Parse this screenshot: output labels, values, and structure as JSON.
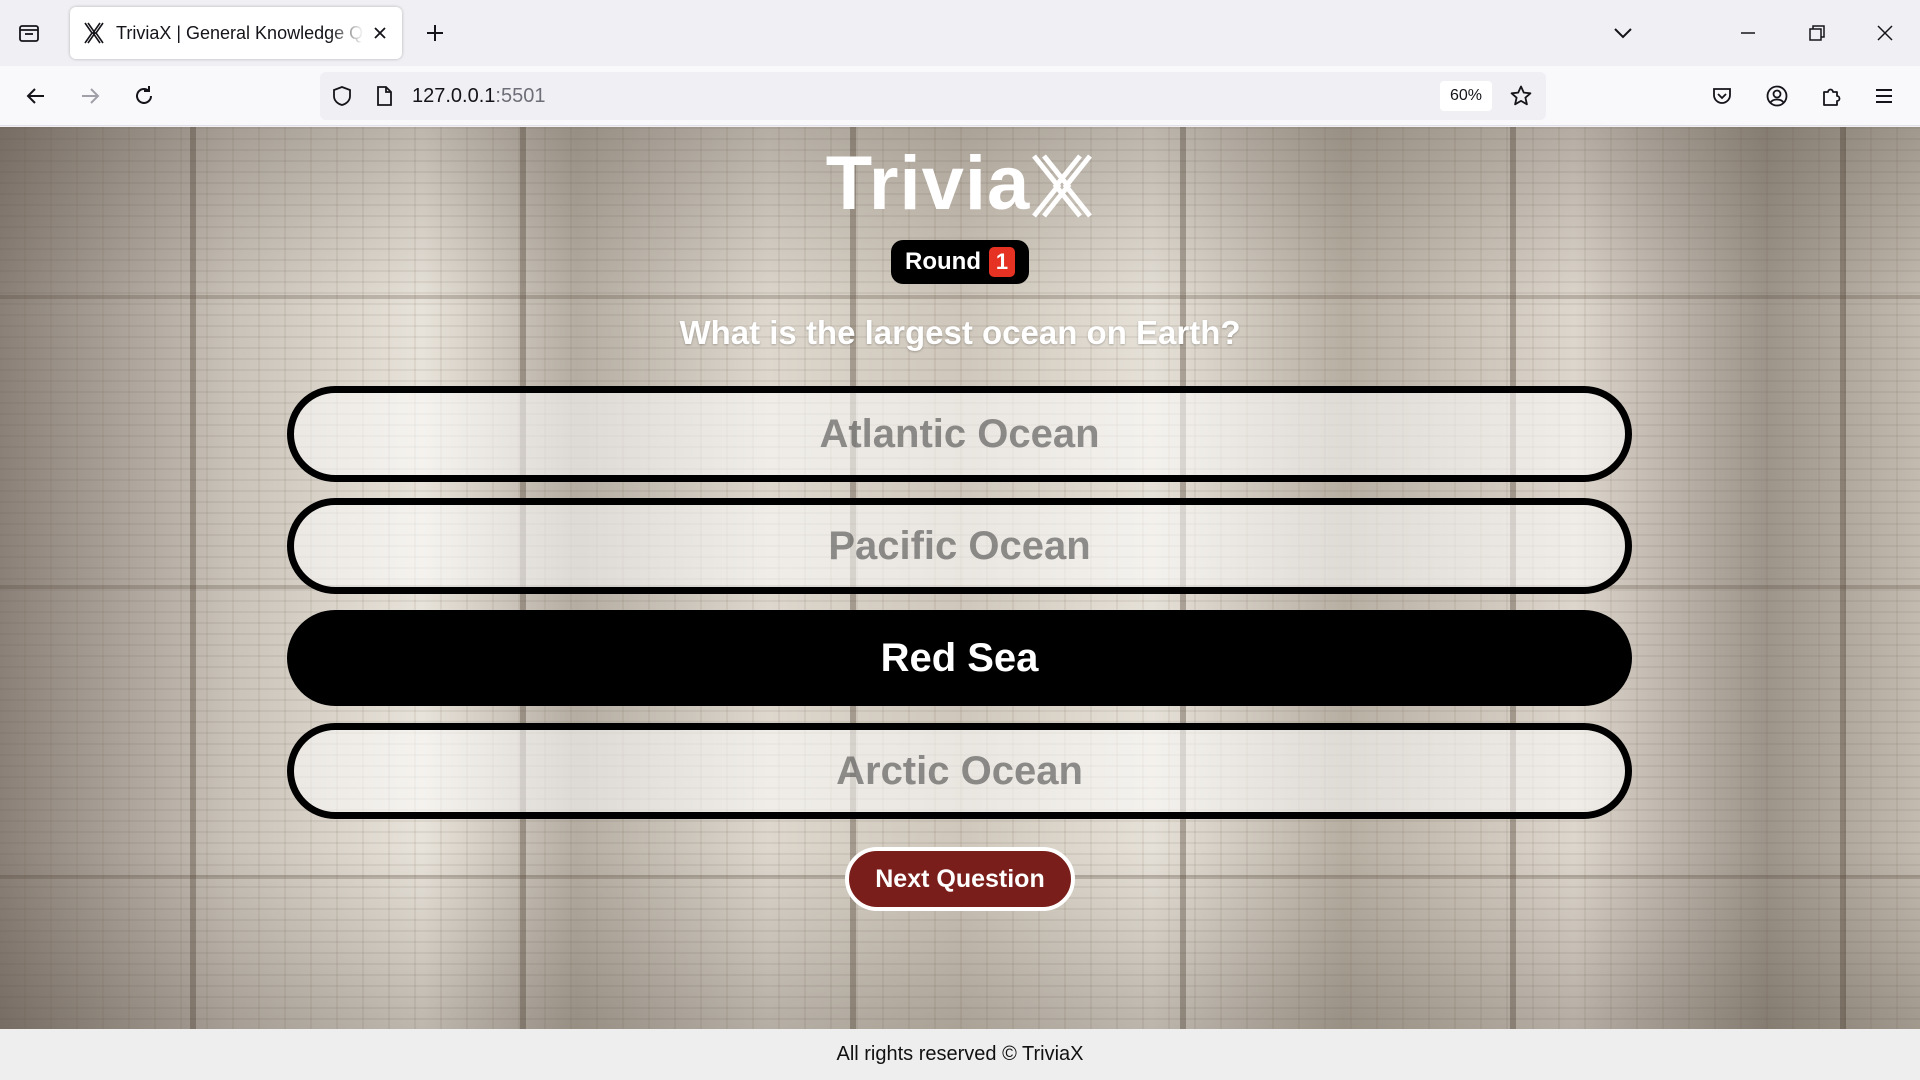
{
  "browser": {
    "tab_title": "TriviaX | General Knowledge Quiz",
    "url_host": "127.0.0.1",
    "url_port": ":5501",
    "zoom": "60%",
    "icons": [
      "tab-list-icon",
      "triviax-favicon-icon",
      "close-icon",
      "plus-icon",
      "chevron-down-icon",
      "minimize-icon",
      "restore-icon",
      "window-close-icon",
      "back-arrow-icon",
      "forward-arrow-icon",
      "reload-icon",
      "shield-icon",
      "page-icon",
      "star-icon",
      "pocket-icon",
      "account-icon",
      "extensions-icon",
      "menu-icon"
    ]
  },
  "quiz": {
    "logo_text": "Trivia",
    "round_label": "Round",
    "round_number": "1",
    "question": "What is the largest ocean on Earth?",
    "answers": [
      {
        "label": "Atlantic Ocean",
        "selected": false
      },
      {
        "label": "Pacific Ocean",
        "selected": false
      },
      {
        "label": "Red Sea",
        "selected": true
      },
      {
        "label": "Arctic Ocean",
        "selected": false
      }
    ],
    "next_label": "Next Question",
    "colors": {
      "accent": "#7a1e1b",
      "round_badge": "#e53223",
      "selected": "#000000"
    }
  },
  "footer": {
    "text": "All rights reserved © TriviaX"
  }
}
